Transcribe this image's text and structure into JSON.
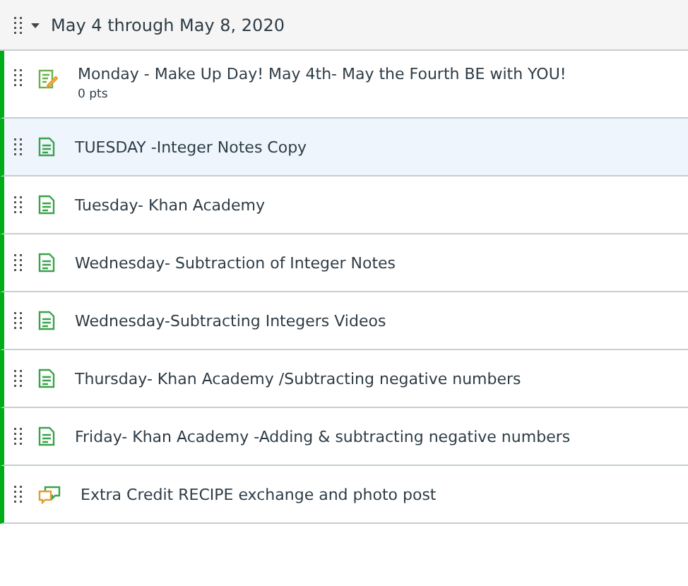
{
  "module": {
    "title": "May 4 through May 8, 2020",
    "expanded": true,
    "items": [
      {
        "kind": "assignment",
        "title": "Monday - Make Up Day! May 4th- May the Fourth BE with YOU!",
        "points": "0 pts",
        "selected": false
      },
      {
        "kind": "page",
        "title": "TUESDAY -Integer Notes Copy",
        "selected": true
      },
      {
        "kind": "page",
        "title": "Tuesday- Khan Academy",
        "selected": false
      },
      {
        "kind": "page",
        "title": "Wednesday- Subtraction of Integer Notes",
        "selected": false
      },
      {
        "kind": "page",
        "title": "Wednesday-Subtracting Integers Videos",
        "selected": false
      },
      {
        "kind": "page",
        "title": "Thursday- Khan Academy /Subtracting negative numbers",
        "selected": false
      },
      {
        "kind": "page",
        "title": "Friday- Khan Academy -Adding & subtracting negative numbers",
        "selected": false
      },
      {
        "kind": "discussion",
        "title": "Extra Credit RECIPE exchange and photo post",
        "selected": false
      }
    ]
  }
}
